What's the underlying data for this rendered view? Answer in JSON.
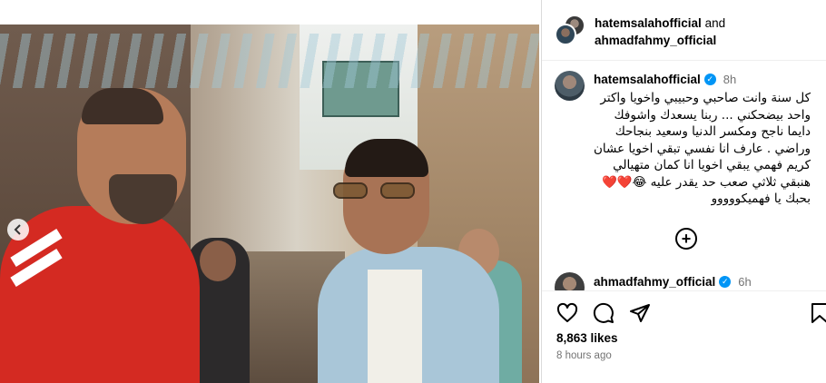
{
  "post": {
    "photo_alt": "",
    "carousel": {
      "dot_count": 2,
      "active_dot": 1
    }
  },
  "header": {
    "user1": "hatemsalahofficial",
    "joiner": "and",
    "user2": "ahmadfahmy_official"
  },
  "caption": {
    "username": "hatemsalahofficial",
    "time": "8h",
    "lines": [
      "كل سنة وانت صاحبي وحبيبي واخويا  واكتر",
      "واحد بيضحكني ... ربنا يسعدك واشوفك",
      "دايما ناجح ومكسر الدنيا وسعيد بنجاحك",
      "وراضي . عارف انا نفسي تبقي اخويا عشان",
      "كريم فهمي يبقي اخويا انا كمان متهيالي",
      "هنبقي ثلاثي صعب حد يقدر عليه 😂❤️❤️",
      "بحبك يا فهميكووووو"
    ]
  },
  "reply": {
    "username": "ahmadfahmy_official",
    "time": "6h"
  },
  "stats": {
    "likes": "8,863 likes",
    "posted_ago": "8 hours ago"
  },
  "icons": {
    "verified": "verified-badge-icon",
    "prev": "chevron-left-icon",
    "plus": "plus-circle-icon",
    "like": "heart-icon",
    "comment": "comment-icon",
    "share": "share-icon",
    "save": "bookmark-icon"
  },
  "colors": {
    "verified": "#0095f6",
    "muted": "#737373",
    "active_dot": "#4d8fe0"
  }
}
